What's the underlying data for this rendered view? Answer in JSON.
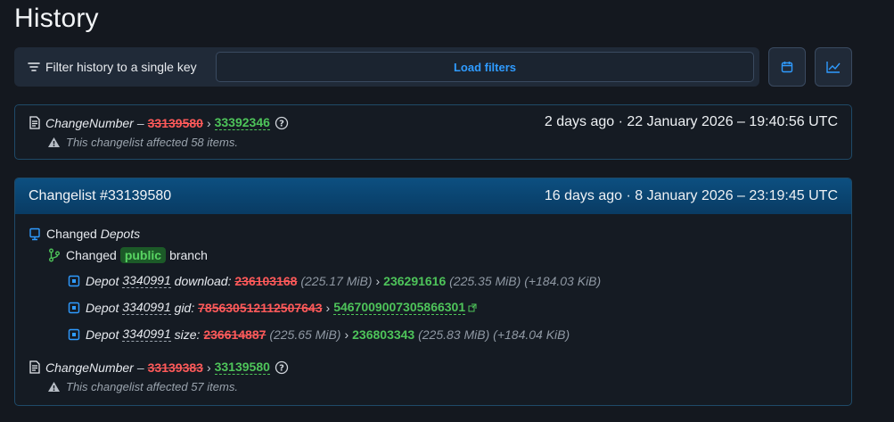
{
  "page": {
    "title": "History"
  },
  "filter": {
    "label": "Filter history to a single key",
    "button": "Load filters"
  },
  "toolbar": {
    "calendar_icon": "calendar-icon",
    "chart_icon": "chart-line-icon"
  },
  "entry1": {
    "key": "ChangeNumber",
    "dash": "–",
    "old_value": "33139580",
    "new_value": "33392346",
    "affected": "This changelist affected 58 items.",
    "date": "2 days ago · 22 January 2026 – 19:40:56 UTC"
  },
  "changelist": {
    "title": "Changelist #33139580",
    "date": "16 days ago · 8 January 2026 – 23:19:45 UTC",
    "changed_label": "Changed",
    "changed_target": "Depots",
    "branch_changed": "Changed",
    "branch_name": "public",
    "branch_word": "branch",
    "depots": [
      {
        "prefix": "Depot",
        "id": "3340991",
        "field": "download:",
        "old": "236103168",
        "old_size": "(225.17 MiB)",
        "new": "236291616",
        "new_size": "(225.35 MiB)",
        "diff": "(+184.03 KiB)"
      },
      {
        "prefix": "Depot",
        "id": "3340991",
        "field": "gid:",
        "old": "785630512112507643",
        "old_size": "",
        "new": "5467009007305866301",
        "new_size": "",
        "diff": ""
      },
      {
        "prefix": "Depot",
        "id": "3340991",
        "field": "size:",
        "old": "236614887",
        "old_size": "(225.65 MiB)",
        "new": "236803343",
        "new_size": "(225.83 MiB)",
        "diff": "(+184.04 KiB)"
      }
    ],
    "change2": {
      "key": "ChangeNumber",
      "dash": "–",
      "old_value": "33139383",
      "new_value": "33139580",
      "affected": "This changelist affected 57 items."
    }
  },
  "arrow": "›",
  "colors": {
    "accent": "#2f9bff",
    "removed": "#ff5a5a",
    "added": "#4ec45a"
  }
}
